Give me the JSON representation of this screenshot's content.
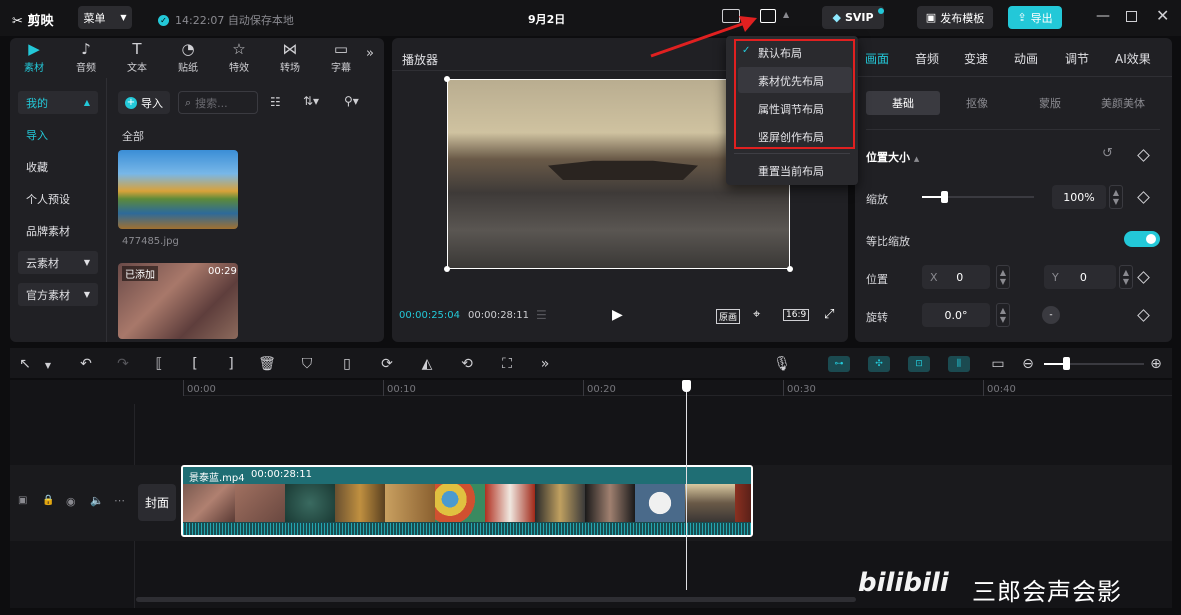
{
  "app": {
    "logo": "剪映",
    "menu": "菜单",
    "autosave": "14:22:07 自动保存本地",
    "project_title": "9月2日",
    "svip": "SVIP",
    "publish_template": "发布模板",
    "export": "导出"
  },
  "left_tabs": [
    {
      "label": "素材",
      "icon": "media-icon"
    },
    {
      "label": "音频",
      "icon": "audio-icon"
    },
    {
      "label": "文本",
      "icon": "text-icon"
    },
    {
      "label": "贴纸",
      "icon": "sticker-icon"
    },
    {
      "label": "特效",
      "icon": "effects-icon"
    },
    {
      "label": "转场",
      "icon": "transition-icon"
    },
    {
      "label": "字幕",
      "icon": "subtitle-icon"
    }
  ],
  "sidebar": {
    "items": [
      "我的",
      "导入",
      "收藏",
      "个人预设",
      "品牌素材",
      "云素材",
      "官方素材"
    ]
  },
  "media": {
    "import": "导入",
    "search_placeholder": "搜索...",
    "section": "全部",
    "items": [
      {
        "name": "477485.jpg"
      },
      {
        "badge": "已添加",
        "duration": "00:29"
      }
    ]
  },
  "player": {
    "title": "播放器",
    "current_time": "00:00:25:04",
    "total_time": "00:00:28:11",
    "btn_original": "原画",
    "btn_ratio": "16:9"
  },
  "layout_menu": {
    "items": [
      "默认布局",
      "素材优先布局",
      "属性调节布局",
      "竖屏创作布局",
      "重置当前布局"
    ],
    "checked": "默认布局"
  },
  "right_tabs": [
    "画面",
    "音频",
    "变速",
    "动画",
    "调节",
    "AI效果"
  ],
  "right_subtabs": [
    "基础",
    "抠像",
    "蒙版",
    "美颜美体"
  ],
  "props": {
    "section": "位置大小",
    "scale_label": "缩放",
    "scale_value": "100%",
    "scale_fraction": 0.2,
    "uniform_label": "等比缩放",
    "position_label": "位置",
    "x_label": "X",
    "x_value": "0",
    "y_label": "Y",
    "y_value": "0",
    "rotate_label": "旋转",
    "rotate_value": "0.0°"
  },
  "timeline": {
    "ruler": [
      "00:00",
      "00:10",
      "00:20",
      "00:30",
      "00:40"
    ],
    "cover": "封面",
    "clip_name": "景泰蓝.mp4",
    "clip_duration": "00:00:28:11",
    "playhead_time_fraction": 0.89
  },
  "watermark": {
    "text": "三郎会声会影",
    "brand": "bilibili"
  },
  "colors": {
    "accent": "#23c8d8",
    "highlight_box": "#e02020",
    "clip_border": "#ffffff",
    "clip_header": "#1f6e74"
  }
}
